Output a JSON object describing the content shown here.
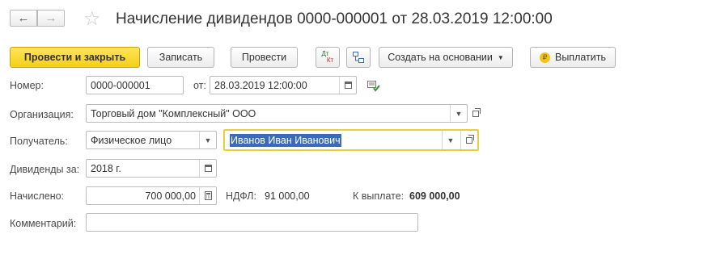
{
  "nav": {
    "back_icon": "←",
    "forward_icon": "→"
  },
  "title": "Начисление дивидендов 0000-000001 от 28.03.2019 12:00:00",
  "toolbar": {
    "post_close": "Провести и закрыть",
    "save": "Записать",
    "post": "Провести",
    "dt_kt_top": "Дт",
    "dt_kt_bottom": "Кт",
    "create_based": "Создать на основании",
    "pay": "Выплатить",
    "pay_icon": "₽"
  },
  "form": {
    "number_label": "Номер:",
    "number_value": "0000-000001",
    "date_label": "от:",
    "date_value": "28.03.2019 12:00:00",
    "org_label": "Организация:",
    "org_value": "Торговый дом \"Комплексный\" ООО",
    "recipient_label": "Получатель:",
    "recipient_type": "Физическое лицо",
    "recipient_value": "Иванов Иван Иванович",
    "period_label": "Дивиденды за:",
    "period_value": "2018 г.",
    "accrued_label": "Начислено:",
    "accrued_value": "700 000,00",
    "ndfl_label": "НДФЛ:",
    "ndfl_value": "91 000,00",
    "payout_label": "К выплате:",
    "payout_value": "609 000,00",
    "comment_label": "Комментарий:",
    "comment_value": ""
  }
}
